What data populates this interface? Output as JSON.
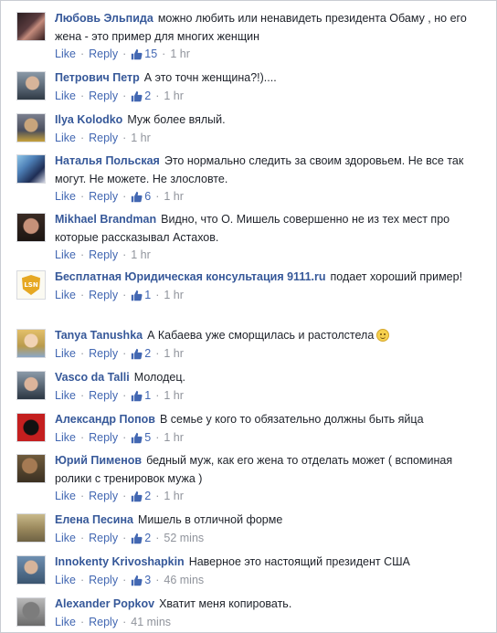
{
  "labels": {
    "like": "Like",
    "reply": "Reply"
  },
  "comments": [
    {
      "author": "Любовь Эльпида",
      "text": "можно любить или ненавидеть президента Обаму , но его жена - это пример для многих женщин",
      "likes": "15",
      "time": "1 hr"
    },
    {
      "author": "Петрович Петр",
      "text": "А это точн женщина?!)....",
      "likes": "2",
      "time": "1 hr"
    },
    {
      "author": "Ilya Kolodko",
      "text": "Муж более вялый.",
      "likes": "",
      "time": "1 hr"
    },
    {
      "author": "Наталья Польская",
      "text": "Это нормально следить за своим здоровьем. Не все так могут. Не можете. Не злословте.",
      "likes": "6",
      "time": "1 hr"
    },
    {
      "author": "Mikhael Brandman",
      "text": "Видно, что О. Мишель совершенно не из тех мест про которые рассказывал Астахов.",
      "likes": "",
      "time": "1 hr"
    },
    {
      "author": "Бесплатная Юридическая консультация 9111.ru",
      "text": "подает хороший пример!",
      "likes": "1",
      "time": "1 hr",
      "avatar_text": "LSN"
    },
    {
      "author": "Tanya Tanushka",
      "text": "А Кабаева уже сморщилась и растолстела",
      "likes": "2",
      "time": "1 hr"
    },
    {
      "author": "Vasco da Talli",
      "text": "Молодец.",
      "likes": "1",
      "time": "1 hr"
    },
    {
      "author": "Александр Попов",
      "text": "В семье у кого то обязательно должны быть яйца",
      "likes": "5",
      "time": "1 hr"
    },
    {
      "author": "Юрий Пименов",
      "text": "бедный муж, как его жена то отделать может ( вспоминая ролики с тренировок мужа )",
      "likes": "2",
      "time": "1 hr"
    },
    {
      "author": "Елена Песина",
      "text": "Мишель в отличной форме",
      "likes": "2",
      "time": "52 mins"
    },
    {
      "author": "Innokenty Krivoshapkin",
      "text": "Наверное это настоящий президент США",
      "likes": "3",
      "time": "46 mins"
    },
    {
      "author": "Alexander Popkov",
      "text": "Хватит меня копировать.",
      "likes": "",
      "time": "41 mins"
    }
  ],
  "colors": {
    "author": "#365899",
    "link": "#4267b2",
    "meta": "#90949c",
    "text": "#1d2129"
  }
}
